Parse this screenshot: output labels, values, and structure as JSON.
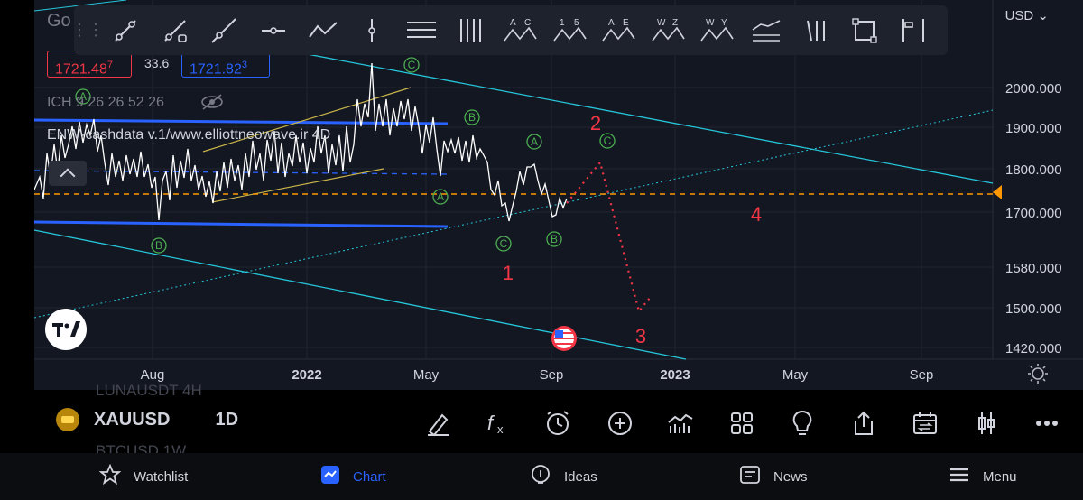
{
  "header": {
    "symbol_title": "Go",
    "currency": "USD",
    "bid_price": "1721.48",
    "bid_price_sup": "7",
    "spread": "33.6",
    "ask_price": "1721.82",
    "ask_price_sup": "3"
  },
  "indicators": {
    "ichimoku": "ICH 9 26 26 52 26",
    "enw": "ENW-cashdata v.1/www.elliottneowave.ir 4D"
  },
  "price_axis": [
    "2000.000",
    "1900.000",
    "1800.000",
    "1700.000",
    "1580.000",
    "1500.000",
    "1420.000"
  ],
  "time_axis": [
    "Aug",
    "2022",
    "May",
    "Sep",
    "2023",
    "May",
    "Sep"
  ],
  "wave_labels": {
    "circled": [
      "A",
      "B",
      "C",
      "A",
      "B",
      "C",
      "A",
      "B",
      "B",
      "C"
    ],
    "numbers": [
      "1",
      "2",
      "3",
      "4"
    ]
  },
  "toolbar": {
    "handle": "⋮⋮",
    "tools": [
      {
        "name": "trend-line-icon",
        "label": ""
      },
      {
        "name": "ray-line-icon",
        "label": ""
      },
      {
        "name": "extended-line-icon",
        "label": ""
      },
      {
        "name": "horizontal-ray-icon",
        "label": ""
      },
      {
        "name": "polyline-icon",
        "label": ""
      },
      {
        "name": "vertical-line-icon",
        "label": ""
      },
      {
        "name": "parallel-channel-icon",
        "label": ""
      },
      {
        "name": "pitchfork-icon",
        "label": ""
      },
      {
        "name": "abc-pattern-icon",
        "label": "A C"
      },
      {
        "name": "elliott-impulse-icon",
        "label": "1 5"
      },
      {
        "name": "elliott-triangle-icon",
        "label": "A E"
      },
      {
        "name": "elliott-double-combo-icon",
        "label": "W Z"
      },
      {
        "name": "elliott-triple-combo-icon",
        "label": "W Y"
      },
      {
        "name": "regression-trend-icon",
        "label": ""
      },
      {
        "name": "cycle-lines-icon",
        "label": ""
      },
      {
        "name": "rectangle-icon",
        "label": ""
      },
      {
        "name": "long-position-icon",
        "label": ""
      }
    ]
  },
  "symbol_bar": {
    "symbol": "XAUUSD",
    "interval": "1D",
    "ghost_above": "LUNAUSDT 4H",
    "ghost_below": "BTCUSD 1W"
  },
  "bottom_tools": [
    "draw-brush-icon",
    "indicators-fx-icon",
    "alert-clock-icon",
    "add-icon",
    "chart-type-icon",
    "layouts-icon",
    "ideas-bulb-icon",
    "share-icon",
    "replay-icon",
    "candles-icon",
    "more-icon"
  ],
  "nav": {
    "watchlist": "Watchlist",
    "chart": "Chart",
    "ideas": "Ideas",
    "news": "News",
    "menu": "Menu"
  },
  "colors": {
    "background": "#131722",
    "channel": "#26c6da",
    "bands": "#2962ff",
    "wave_green": "#4caf50",
    "wave_red": "#f23645",
    "current_price_line": "#ff9800",
    "accent": "#2962ff"
  }
}
